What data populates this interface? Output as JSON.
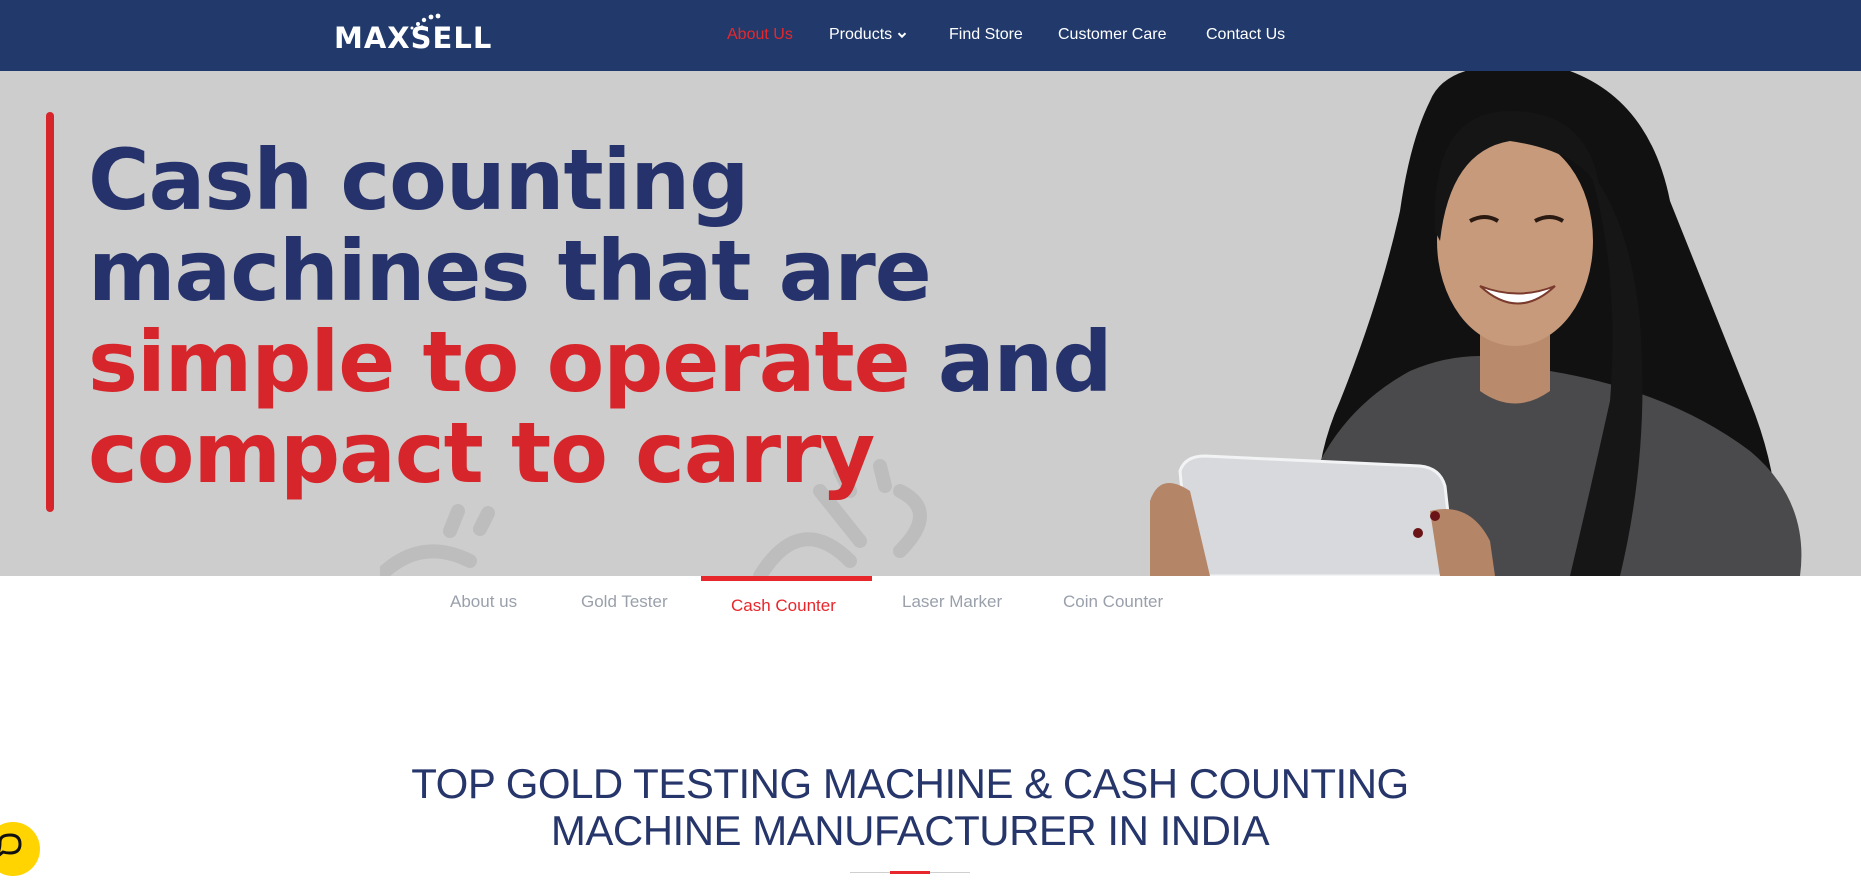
{
  "brand": {
    "logo_text": "MAXSELL",
    "color_primary": "#213a6b",
    "color_accent": "#e8272c"
  },
  "nav": {
    "items": [
      {
        "label": "About Us",
        "active": true
      },
      {
        "label": "Products",
        "has_dropdown": true
      },
      {
        "label": "Find Store"
      },
      {
        "label": "Customer Care"
      },
      {
        "label": "Contact Us"
      }
    ]
  },
  "hero": {
    "line1": "Cash counting",
    "line2": "machines that are",
    "line3_red": "simple to operate",
    "line3_blue": " and",
    "line4_red": "compact to carry"
  },
  "tabs": {
    "items": [
      {
        "label": "About us"
      },
      {
        "label": "Gold Tester"
      },
      {
        "label": "Cash Counter",
        "active": true
      },
      {
        "label": "Laser Marker"
      },
      {
        "label": "Coin Counter"
      }
    ]
  },
  "section": {
    "title_line1": "TOP GOLD TESTING MACHINE & CASH COUNTING",
    "title_line2": "MACHINE MANUFACTURER IN INDIA"
  },
  "chat": {
    "icon": "chat-bubble-icon",
    "color": "#ffd400"
  }
}
